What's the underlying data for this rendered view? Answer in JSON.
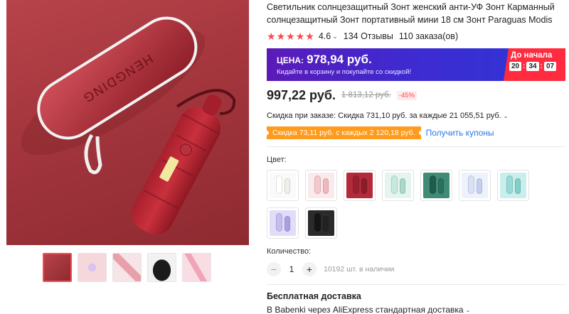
{
  "product": {
    "title": "Светильник солнцезащитный Зонт женский анти-УФ Зонт Карманный солнцезащитный Зонт портативный мини 18 см Зонт Paraguas Modis",
    "image_text": "HENGDING",
    "rating": "4.6",
    "stars": 5,
    "reviews": "134 Отзывы",
    "orders": "110 заказа(ов)"
  },
  "promo": {
    "label": "ЦЕНА:",
    "price": "978,94 руб.",
    "subtitle": "Кидайте в корзину и покупайте со скидкой!",
    "countdown_label": "До начала",
    "timer": [
      "20",
      "34",
      "07"
    ]
  },
  "pricing": {
    "price": "997,22 руб.",
    "old_price": "1 813,12 руб.",
    "discount": "-45%"
  },
  "order_discount": "Скидка при заказе: Скидка 731,10 руб. за каждые 21 055,51 руб.",
  "coupon": {
    "tag": "Скидка 73,11 руб. с каждых 2 120,18 руб.",
    "link": "Получить купоны"
  },
  "color_label": "Цвет:",
  "colors": [
    {
      "case": "#ffffff",
      "umb": "#f1efe9",
      "bg": "#fafafa"
    },
    {
      "case": "#f4c9cd",
      "umb": "#f0b9bf",
      "bg": "#fbeaec"
    },
    {
      "case": "#9a2030",
      "umb": "#8d1c2a",
      "bg": "#b32b3a"
    },
    {
      "case": "#c7e9dc",
      "umb": "#aad9c8",
      "bg": "#e4f5ef"
    },
    {
      "case": "#1f5c4c",
      "umb": "#2b6f5d",
      "bg": "#3f8b76"
    },
    {
      "case": "#d9e1f6",
      "umb": "#c5d0f0",
      "bg": "#eef2fc"
    },
    {
      "case": "#96dbd6",
      "umb": "#7fd0ca",
      "bg": "#c9eeeb"
    },
    {
      "case": "#c4bdf0",
      "umb": "#a9a1e6",
      "bg": "#e1ddf8"
    },
    {
      "case": "#151515",
      "umb": "#222222",
      "bg": "#2b2b2b"
    }
  ],
  "quantity": {
    "label": "Количество:",
    "minus": "−",
    "value": "1",
    "plus": "+",
    "stock": "10192 шт. в наличии"
  },
  "delivery": {
    "title": "Бесплатная доставка",
    "subtitle": "В Babenki через AliExpress стандартная доставка"
  },
  "thumbnails": [
    {
      "color": "#a3353d"
    },
    {
      "color": "#f5d7dc"
    },
    {
      "color": "#f7e4e6"
    },
    {
      "color": "#f2f2f2"
    },
    {
      "color": "#f9dce4"
    }
  ],
  "accent_color": "#ff4747"
}
